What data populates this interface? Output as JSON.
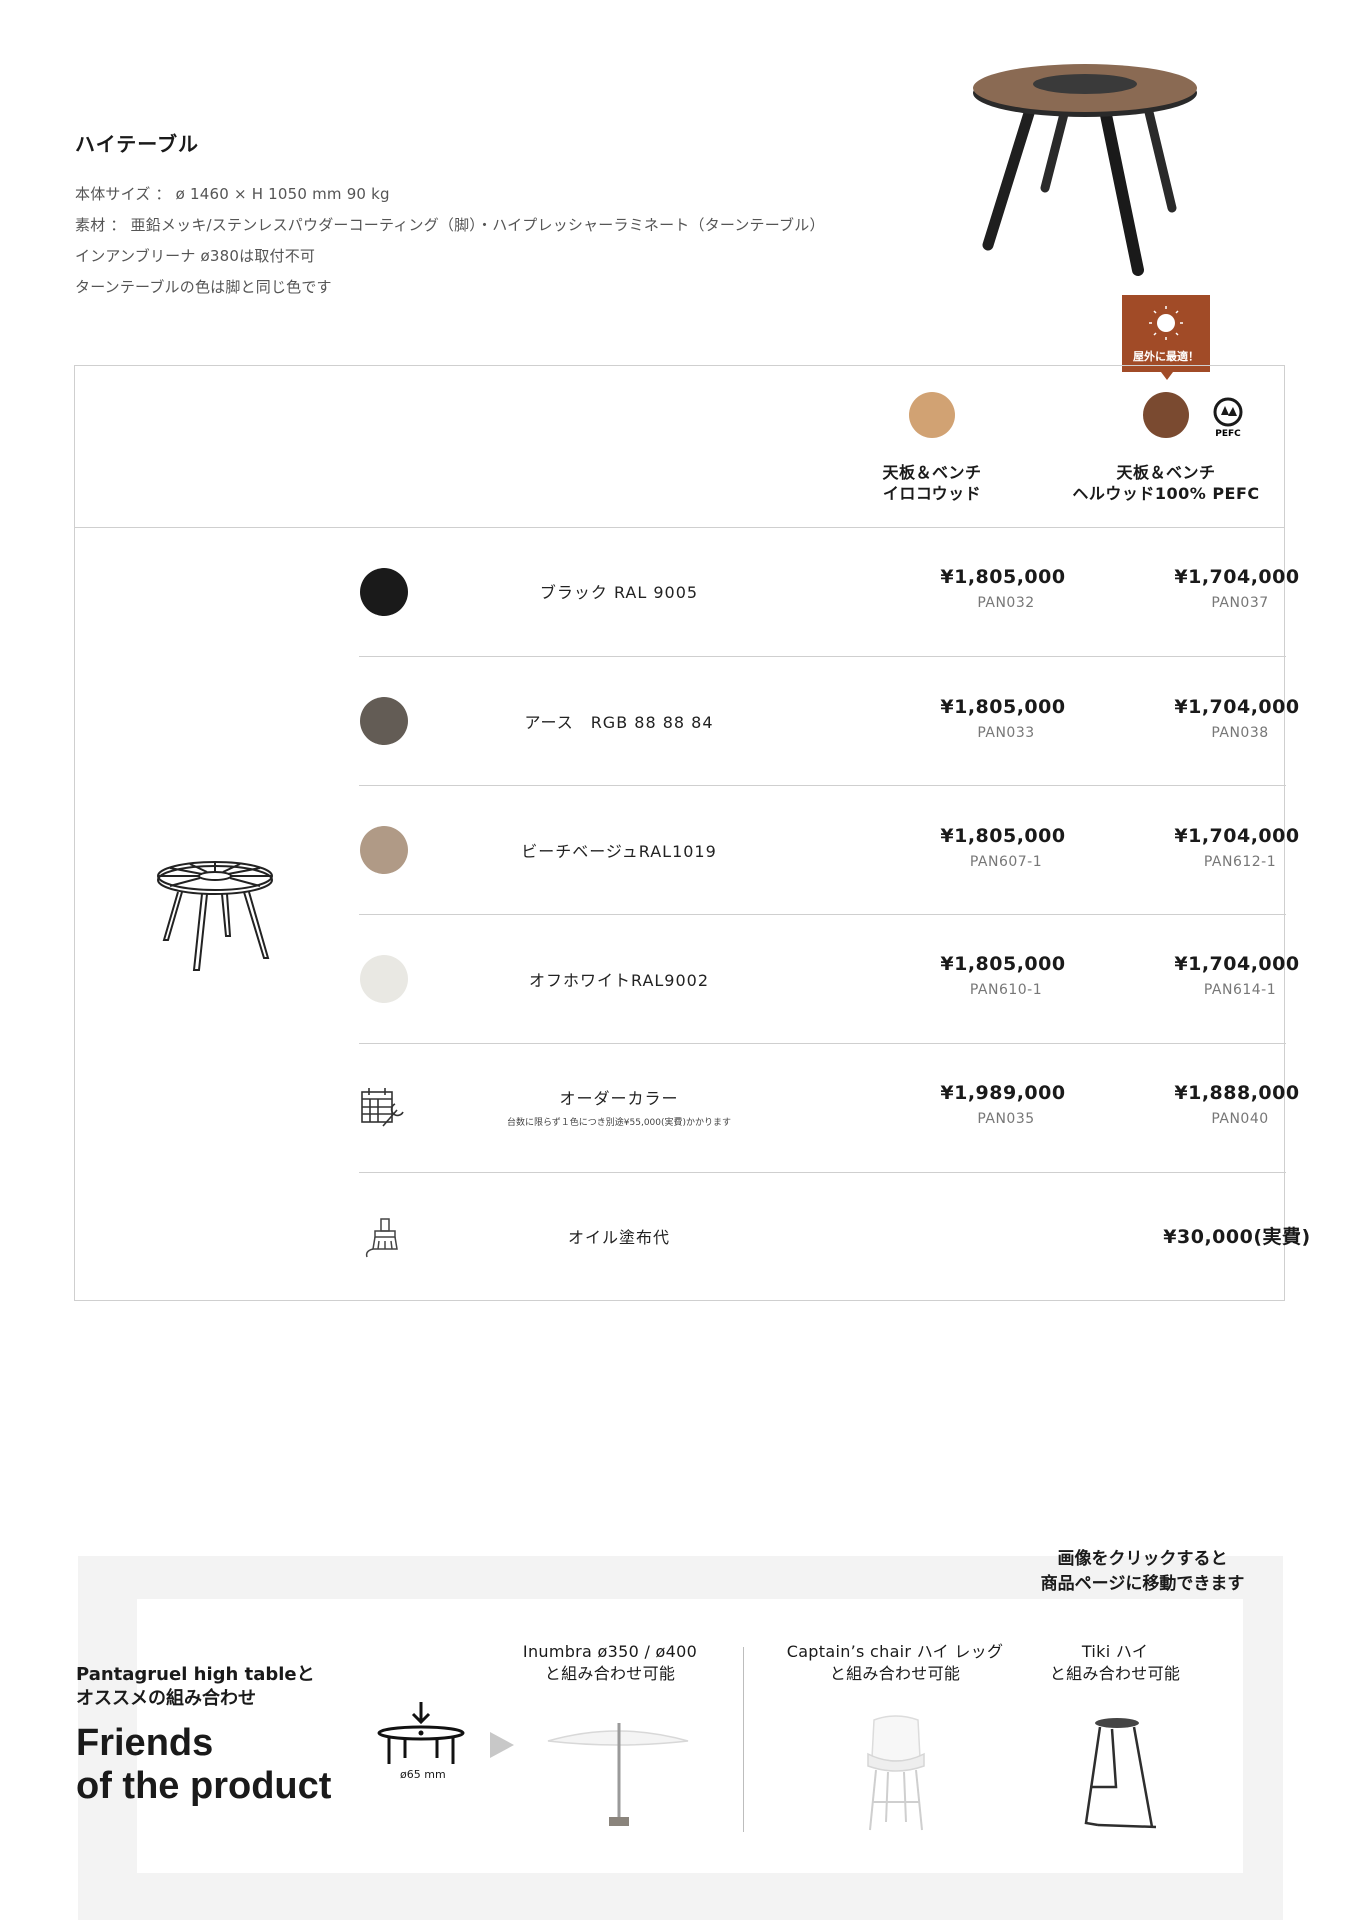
{
  "intro": {
    "title": "ハイテーブル",
    "specs": [
      "本体サイズ ： ø 1460 × H 1050 mm 90 kg",
      "素材 ： 亜鉛メッキ/ステンレスパウダーコーティング（脚）・ハイプレッシャーラミネート（ターンテーブル）",
      "インアンブリーナ ø380は取付不可",
      "ターンテーブルの色は脚と同じ色です"
    ]
  },
  "badge": {
    "label": "屋外に最適！"
  },
  "columns": [
    {
      "title_line1": "天板＆ベンチ",
      "title_line2": "イロコウッド",
      "swatch_color": "#d1a273"
    },
    {
      "title_line1": "天板＆ベンチ",
      "title_line2": "ヘルウッド100% PEFC",
      "swatch_color": "#7a4a30"
    }
  ],
  "pefc": {
    "text": "PEFC"
  },
  "rows": [
    {
      "name": "ブラック RAL 9005",
      "dot_color": "#1a1a1a",
      "price1": "¥1,805,000",
      "code1": "PAN032",
      "price2": "¥1,704,000",
      "code2": "PAN037"
    },
    {
      "name": "アース　RGB 88 88 84",
      "dot_color": "#635c55",
      "price1": "¥1,805,000",
      "code1": "PAN033",
      "price2": "¥1,704,000",
      "code2": "PAN038"
    },
    {
      "name": "ビーチベージュRAL1019",
      "dot_color": "#b09a86",
      "price1": "¥1,805,000",
      "code1": "PAN607-1",
      "price2": "¥1,704,000",
      "code2": "PAN612-1"
    },
    {
      "name": "オフホワイトRAL9002",
      "dot_color": "#e9e8e3",
      "price1": "¥1,805,000",
      "code1": "PAN610-1",
      "price2": "¥1,704,000",
      "code2": "PAN614-1"
    },
    {
      "name": "オーダーカラー",
      "note": "台数に限らず１色につき別途¥55,000(実費)かかります",
      "icon": "calendar-wrench-icon",
      "price1": "¥1,989,000",
      "code1": "PAN035",
      "price2": "¥1,888,000",
      "code2": "PAN040"
    },
    {
      "name": "オイル塗布代",
      "icon": "brush-icon",
      "price2": "¥30,000(実費)"
    }
  ],
  "friends": {
    "click_note_line1": "画像をクリックすると",
    "click_note_line2": "商品ページに移動できます",
    "subtitle_line1": "Pantagruel high tableと",
    "subtitle_line2": "オススメの組み合わせ",
    "title_line1": "Friends",
    "title_line2": "of the product",
    "dimension": "ø65 mm",
    "items": [
      {
        "line1": "Inumbra ø350 / ø400",
        "line2": "と組み合わせ可能"
      },
      {
        "line1": "Captain’s chair ハイ レッグ",
        "line2": "と組み合わせ可能"
      },
      {
        "line1": "Tiki ハイ",
        "line2": "と組み合わせ可能"
      }
    ]
  }
}
